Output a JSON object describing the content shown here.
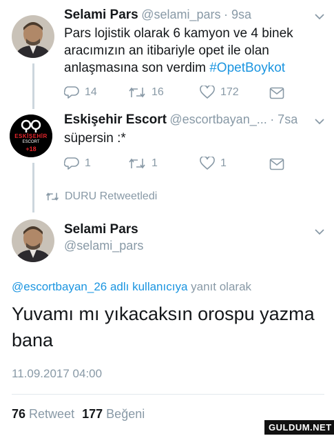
{
  "tweet1": {
    "name": "Selami Pars",
    "handle": "@selami_pars",
    "time": "· 9sa",
    "text_prefix": "Pars lojistik olarak 6  kamyon ve 4 binek aracımızın an itibariyle opet ile olan anlaşmasına son verdim ",
    "hashtag": "#OpetBoykot",
    "replies": "14",
    "retweets": "16",
    "likes": "172"
  },
  "tweet2": {
    "name": "Eskişehir Escort",
    "handle": "@escortbayan_...",
    "time": "· 7sa",
    "text": "süpersin :*",
    "replies": "1",
    "retweets": "1",
    "likes": "1",
    "avatar": {
      "line1": "ESKİŞEHİR",
      "line2": "ESCORT",
      "line3": "+18"
    }
  },
  "retweet_banner": "DURU Retweetledi",
  "main": {
    "name": "Selami Pars",
    "handle": "@selami_pars",
    "reply_to_handle": "@escortbayan_26 adlı kullanıcıya",
    "reply_to_suffix": " yanıt olarak",
    "text": "Yuvamı mı yıkacaksın orospu yazma bana",
    "datetime": "11.09.2017 04:00",
    "retweet_count": "76",
    "retweet_label": "Retweet",
    "like_count": "177",
    "like_label": "Beğeni"
  },
  "watermark": "GULDUM.NET",
  "colors": {
    "accent": "#1b95e0",
    "muted": "#8899a6",
    "text": "#14171a"
  }
}
